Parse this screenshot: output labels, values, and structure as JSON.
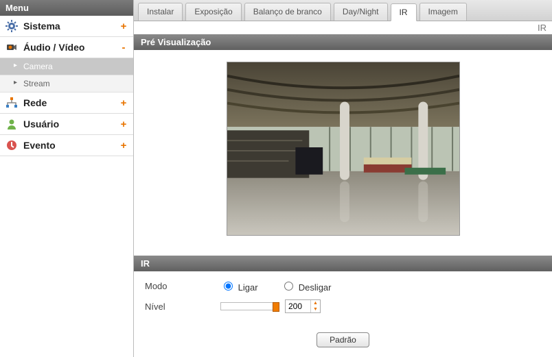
{
  "sidebar": {
    "title": "Menu",
    "items": [
      {
        "label": "Sistema",
        "expand": "+"
      },
      {
        "label": "Áudio / Vídeo",
        "expand": "-"
      },
      {
        "label": "Rede",
        "expand": "+"
      },
      {
        "label": "Usuário",
        "expand": "+"
      },
      {
        "label": "Evento",
        "expand": "+"
      }
    ],
    "submenu": [
      {
        "label": "Camera"
      },
      {
        "label": "Stream"
      }
    ]
  },
  "tabs": [
    {
      "label": "Instalar"
    },
    {
      "label": "Exposição"
    },
    {
      "label": "Balanço de branco"
    },
    {
      "label": "Day/Night"
    },
    {
      "label": "IR"
    },
    {
      "label": "Imagem"
    }
  ],
  "breadcrumb": "IR",
  "sections": {
    "preview": "Pré Visualização",
    "settings": "IR"
  },
  "settings": {
    "mode_label": "Modo",
    "mode_on": "Ligar",
    "mode_off": "Desligar",
    "level_label": "Nível",
    "level_value": "200"
  },
  "buttons": {
    "default": "Padrão"
  }
}
